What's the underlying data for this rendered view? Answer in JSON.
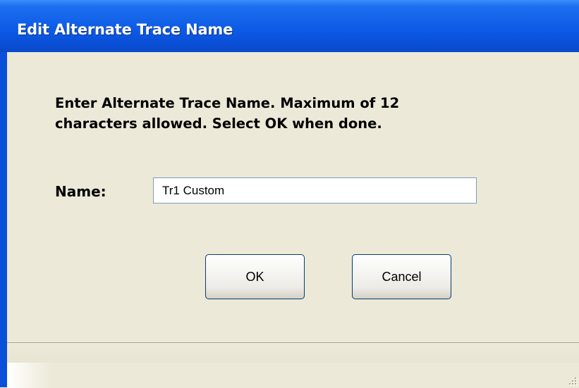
{
  "window": {
    "title": "Edit Alternate Trace Name"
  },
  "dialog": {
    "prompt_line1": "Enter Alternate Trace Name. Maximum of 12",
    "prompt_line2": "characters allowed.  Select OK when done.",
    "name_label": "Name:",
    "name_value": "Tr1 Custom",
    "ok_label": "OK",
    "cancel_label": "Cancel"
  },
  "statusbar": {
    "grip_icon": "resize-grip-icon"
  },
  "colors": {
    "titlebar": "#0a4fd6",
    "face": "#ece9d8",
    "button_border": "#003c74",
    "input_border": "#7f9db9"
  }
}
